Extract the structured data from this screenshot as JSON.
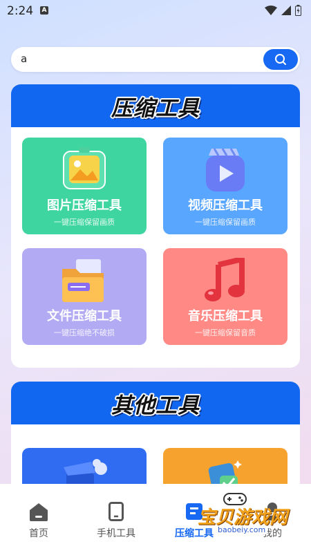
{
  "status_bar": {
    "time": "2:24",
    "notification_glyph": "A"
  },
  "search": {
    "value": "a"
  },
  "compress_section": {
    "title": "压缩工具",
    "tiles": [
      {
        "title": "图片压缩工具",
        "subtitle": "一键压缩保留画质",
        "color": "#3fd5a1",
        "icon": "image-icon"
      },
      {
        "title": "视频压缩工具",
        "subtitle": "一键压缩保留画质",
        "color": "#59a6ff",
        "icon": "video-icon"
      },
      {
        "title": "文件压缩工具",
        "subtitle": "一键压缩绝不破损",
        "color": "#b3aaf4",
        "icon": "folder-icon"
      },
      {
        "title": "音乐压缩工具",
        "subtitle": "一键压缩保留音质",
        "color": "#ff8a85",
        "icon": "music-icon"
      }
    ]
  },
  "other_section": {
    "title": "其他工具",
    "tiles": [
      {
        "color": "#2f6cf2",
        "icon": "cleaner-icon"
      },
      {
        "color": "#f5a32e",
        "icon": "phone-check-icon"
      }
    ]
  },
  "bottom_nav": {
    "items": [
      {
        "label": "首页",
        "icon": "home-icon"
      },
      {
        "label": "手机工具",
        "icon": "phone-icon"
      },
      {
        "label": "压缩工具",
        "icon": "compress-icon",
        "active": true
      },
      {
        "label": "我的",
        "icon": "profile-icon"
      }
    ]
  },
  "watermark": {
    "text": "宝贝游戏网",
    "url": "baobeiy.com"
  },
  "colors": {
    "accent": "#1769f3",
    "header_blue": "#1167f0"
  }
}
